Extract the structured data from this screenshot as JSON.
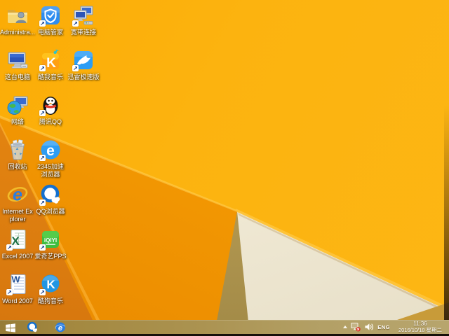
{
  "desktop": {
    "icons": [
      {
        "name": "administrator-folder",
        "label": "Administra..."
      },
      {
        "name": "this-pc",
        "label": "这台电脑"
      },
      {
        "name": "network",
        "label": "网络"
      },
      {
        "name": "recycle-bin",
        "label": "回收站"
      },
      {
        "name": "internet-explorer",
        "label": "Internet Explorer"
      },
      {
        "name": "excel-2007",
        "label": "Excel 2007"
      },
      {
        "name": "word-2007",
        "label": "Word 2007"
      },
      {
        "name": "pc-manager",
        "label": "电脑管家"
      },
      {
        "name": "kuwo-music",
        "label": "酷我音乐"
      },
      {
        "name": "tencent-qq",
        "label": "腾讯QQ"
      },
      {
        "name": "2345-browser",
        "label": "2345加速浏览器"
      },
      {
        "name": "qq-browser",
        "label": "QQ浏览器"
      },
      {
        "name": "iqiyi-pps",
        "label": "爱奇艺PPS"
      },
      {
        "name": "kugou-music",
        "label": "酷狗音乐"
      },
      {
        "name": "broadband-connection",
        "label": "宽带连接"
      },
      {
        "name": "xunlei-speed",
        "label": "迅雷极速版"
      }
    ]
  },
  "taskbar": {
    "pinned": [
      "start-button",
      "qq-browser",
      "internet-explorer"
    ]
  },
  "tray": {
    "language": "ENG",
    "time": "11:36",
    "date": "2016/10/18 星期二"
  },
  "colors": {
    "wallpaper_base": "#fcb10d",
    "wallpaper_mid": "#f29702",
    "wallpaper_shadow": "#dd7d0e",
    "wallpaper_khaki": "#b59a52",
    "wallpaper_cream": "#f0e9d4",
    "taskbar": "#ab9351",
    "taskbar_text": "#ffffff"
  }
}
